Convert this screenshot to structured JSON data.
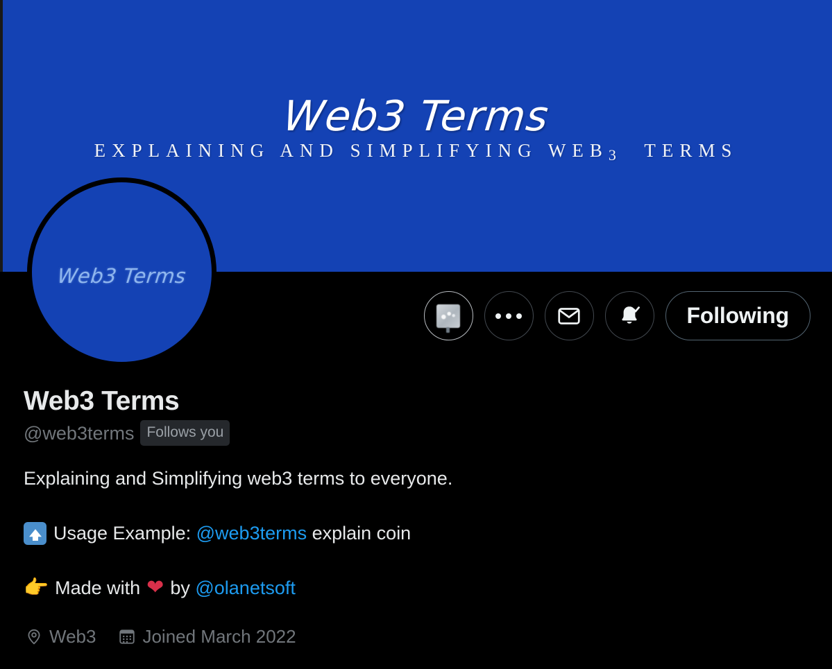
{
  "colors": {
    "banner_blue": "#1442B4",
    "page_background": "#000000",
    "link_blue": "#1D9BF0",
    "muted_text": "#71767B",
    "primary_text": "#E7E9EA",
    "badge_background": "#25282C",
    "avatar_label_blue": "#8FB6EE",
    "heart_red": "#D9304A",
    "border_gray": "#536471"
  },
  "banner": {
    "title": "Web3 Terms",
    "subtitle_prefix": "EXPLAINING AND SIMPLIFYING WEB",
    "subtitle_three": "3",
    "subtitle_suffix": "TERMS"
  },
  "avatar": {
    "label": "Web3 Terms",
    "alt": "profile-photo"
  },
  "actions": {
    "buttons": [
      {
        "name": "highlights-icon-button",
        "icon": "screen-chart-emoji-icon",
        "focused": true
      },
      {
        "name": "more-options-button",
        "icon": "three-dots-icon",
        "focused": false
      },
      {
        "name": "message-button",
        "icon": "envelope-icon",
        "focused": false
      },
      {
        "name": "notifications-button",
        "icon": "bell-check-icon",
        "focused": false
      }
    ],
    "follow_label": "Following"
  },
  "profile": {
    "display_name": "Web3 Terms",
    "handle": "@web3terms",
    "follows_you_badge": "Follows you",
    "bio": {
      "line1": "Explaining and Simplifying web3 terms to everyone.",
      "line2_prefix": "Usage Example:",
      "line2_mention": "@web3terms",
      "line2_suffix": "explain coin",
      "line3_prefix": "Made with",
      "line3_middle": "by",
      "line3_mention": "@olanetsoft"
    }
  },
  "meta": {
    "location_icon": "location-pin-icon",
    "location": "Web3",
    "joined_icon": "calendar-icon",
    "joined": "Joined March 2022"
  }
}
